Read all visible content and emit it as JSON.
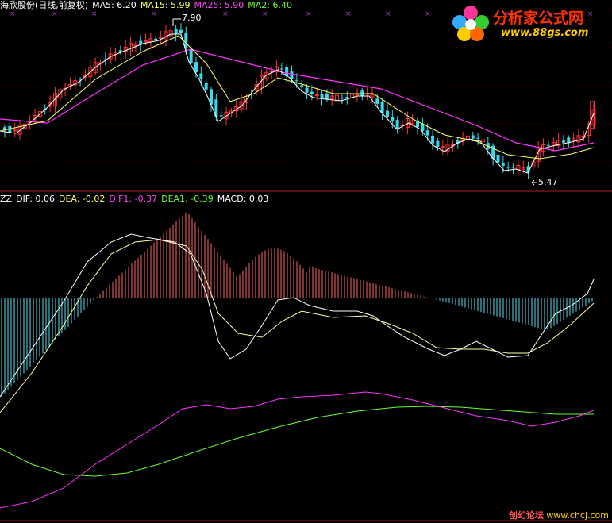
{
  "header_price": {
    "title": "海欣股份(日线,前复权)",
    "ma5": "MA5: 6.20",
    "ma15": "MA15: 5.99",
    "ma25": "MA25: 5.90",
    "ma2": "MA2: 6.40"
  },
  "header_indicator": {
    "name": "ZZ",
    "dif": "DIF: 0.06",
    "dea": "DEA: -0.02",
    "dif1": "DIF1: -0.37",
    "dea1": "DEA1: -0.39",
    "macd": "MACD: 0.03"
  },
  "annotations": {
    "high": "7.90",
    "low": "5.47"
  },
  "watermark": {
    "title": "分析家公式网",
    "url": "www.88gs.com"
  },
  "watermark2": {
    "label": "创幻论坛",
    "url": "www.chcj.com"
  },
  "colors": {
    "up": "#ff3333",
    "down": "#33ddee",
    "ma_white": "#ffffff",
    "ma_yellow": "#ffff66",
    "ma_magenta": "#ff33ff",
    "green": "#66ff33",
    "bar_pos": "#ff6666",
    "bar_neg": "#55e0f0"
  },
  "chart_data": [
    {
      "type": "candlestick",
      "title": "海欣股份(日线,前复权)",
      "ylim": [
        5.3,
        8.1
      ],
      "high": 7.9,
      "low": 5.47,
      "series_names": [
        "MA5",
        "MA15",
        "MA25",
        "MA2"
      ]
    },
    {
      "type": "line",
      "title": "ZZ",
      "series_names": [
        "DIF",
        "DEA",
        "DIF1",
        "DEA1",
        "MACD"
      ],
      "last_values": {
        "DIF": 0.06,
        "DEA": -0.02,
        "DIF1": -0.37,
        "DEA1": -0.39,
        "MACD": 0.03
      }
    }
  ]
}
